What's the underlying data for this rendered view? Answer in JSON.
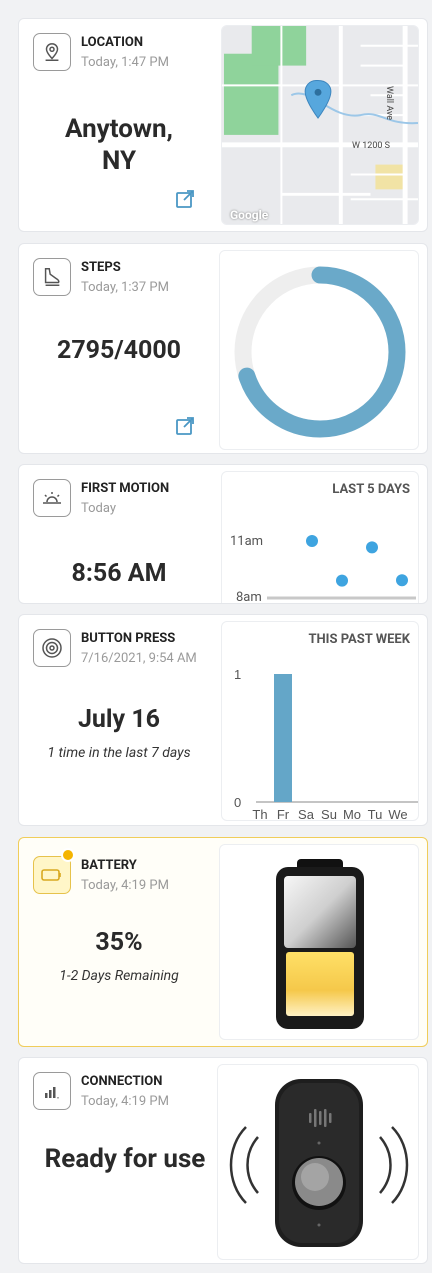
{
  "location": {
    "title": "LOCATION",
    "time": "Today, 1:47 PM",
    "city_line1": "Anytown,",
    "city_line2": "NY",
    "map": {
      "road_label_1": "W 1200 S",
      "road_label_2": "Wall Ave",
      "attribution": "Google"
    }
  },
  "steps": {
    "title": "STEPS",
    "time": "Today, 1:37 PM",
    "value": "2795/4000",
    "progress": 0.699
  },
  "first_motion": {
    "title": "FIRST MOTION",
    "time": "Today",
    "value": "8:56 AM",
    "chart_title": "LAST 5 DAYS",
    "y_labels": [
      "11am",
      "8am"
    ]
  },
  "button_press": {
    "title": "BUTTON PRESS",
    "time": "7/16/2021, 9:54 AM",
    "value": "July 16",
    "detail": "1 time in the last 7 days",
    "chart_title": "THIS PAST WEEK"
  },
  "battery": {
    "title": "BATTERY",
    "time": "Today, 4:19 PM",
    "value": "35%",
    "detail": "1-2 Days Remaining",
    "level": 0.35
  },
  "connection": {
    "title": "CONNECTION",
    "time": "Today, 4:19 PM",
    "value": "Ready for use"
  },
  "chart_data": [
    {
      "type": "scatter",
      "title": "LAST 5 DAYS",
      "ylabel": "",
      "y_ticks": [
        "11am",
        "8am"
      ],
      "points": [
        {
          "x": 1,
          "y": "11:00"
        },
        {
          "x": 2,
          "y": "8:55"
        },
        {
          "x": 3,
          "y": "10:40"
        },
        {
          "x": 4,
          "y": "8:56"
        }
      ],
      "note": ""
    },
    {
      "type": "bar",
      "title": "THIS PAST WEEK",
      "categories": [
        "Th",
        "Fr",
        "Sa",
        "Su",
        "Mo",
        "Tu",
        "We"
      ],
      "values": [
        0,
        1,
        0,
        0,
        0,
        0,
        0
      ],
      "ylim": [
        0,
        1
      ],
      "y_ticks": [
        "1",
        "0"
      ]
    }
  ]
}
